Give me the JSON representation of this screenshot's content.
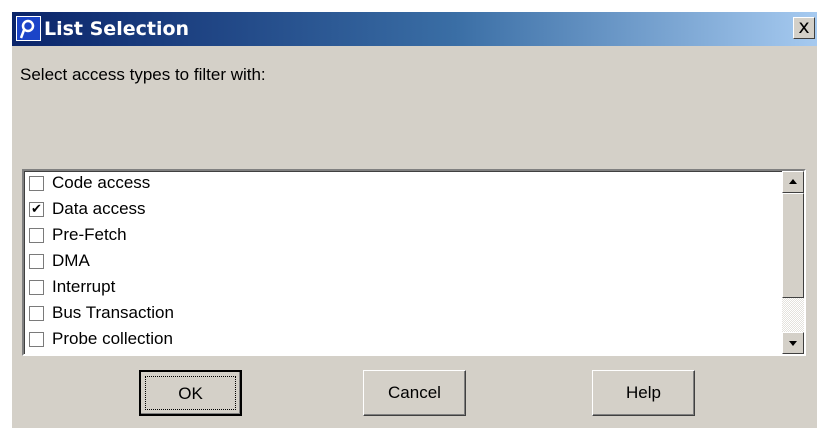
{
  "window": {
    "title": "List Selection",
    "close_glyph": "x",
    "app_icon": "app-icon"
  },
  "instruction": "Select access types to filter with:",
  "list": {
    "items": [
      {
        "label": "Code access",
        "checked": false
      },
      {
        "label": "Data access",
        "checked": true
      },
      {
        "label": "Pre-Fetch",
        "checked": false
      },
      {
        "label": "DMA",
        "checked": false
      },
      {
        "label": "Interrupt",
        "checked": false
      },
      {
        "label": "Bus Transaction",
        "checked": false
      },
      {
        "label": "Probe collection",
        "checked": false
      }
    ]
  },
  "buttons": {
    "ok": "OK",
    "cancel": "Cancel",
    "help": "Help"
  },
  "colors": {
    "title_start": "#0a246a",
    "title_end": "#a6caf0",
    "dialog_bg": "#d4d0c8"
  }
}
